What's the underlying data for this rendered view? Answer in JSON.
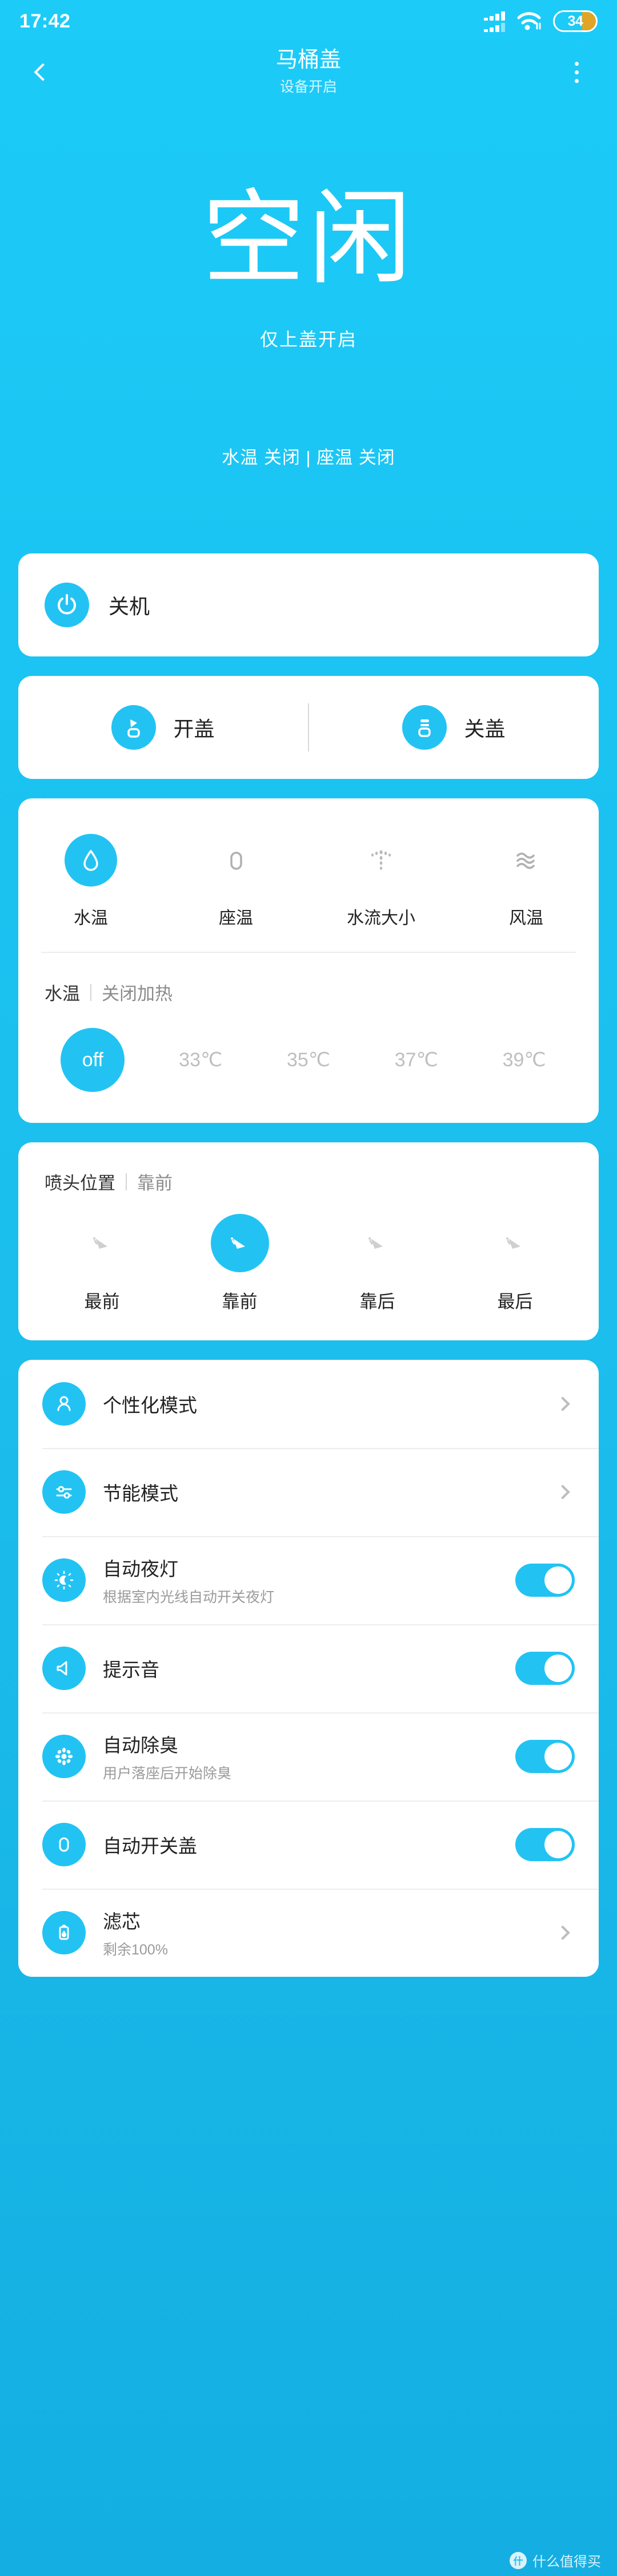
{
  "statusbar": {
    "time": "17:42",
    "battery_level": "34",
    "battery_fill_color": "#E0A526",
    "signal_icon": "signal-bars-icon",
    "wifi_icon": "wifi-icon"
  },
  "header": {
    "back_icon": "back-chevron-icon",
    "title": "马桶盖",
    "subtitle": "设备开启",
    "menu_icon": "more-vertical-icon"
  },
  "hero": {
    "state": "空闲",
    "sub": "仅上盖开启",
    "temps": "水温 关闭 | 座温 关闭"
  },
  "theme": {
    "accent": "#22C3F3",
    "background": "#1BC4F2",
    "card": "#FFFFFF"
  },
  "power_card": {
    "icon": "power-icon",
    "label": "关机"
  },
  "lid_card": {
    "open": {
      "icon": "lid-open-icon",
      "label": "开盖"
    },
    "close": {
      "icon": "lid-close-icon",
      "label": "关盖"
    }
  },
  "function_card": {
    "items": [
      {
        "icon": "water-drop-icon",
        "label": "水温",
        "active": true
      },
      {
        "icon": "toilet-seat-icon",
        "label": "座温",
        "active": false
      },
      {
        "icon": "water-spray-icon",
        "label": "水流大小",
        "active": false
      },
      {
        "icon": "wind-wave-icon",
        "label": "风温",
        "active": false
      }
    ],
    "setting_key": "水温",
    "setting_value": "关闭加热",
    "options": [
      {
        "label": "off",
        "selected": true
      },
      {
        "label": "33℃",
        "selected": false
      },
      {
        "label": "35℃",
        "selected": false
      },
      {
        "label": "37℃",
        "selected": false
      },
      {
        "label": "39℃",
        "selected": false
      }
    ]
  },
  "nozzle_card": {
    "setting_key": "喷头位置",
    "setting_value": "靠前",
    "options": [
      {
        "icon": "nozzle-position-icon",
        "label": "最前",
        "selected": false
      },
      {
        "icon": "nozzle-position-icon",
        "label": "靠前",
        "selected": true
      },
      {
        "icon": "nozzle-position-icon",
        "label": "靠后",
        "selected": false
      },
      {
        "icon": "nozzle-position-icon",
        "label": "最后",
        "selected": false
      }
    ]
  },
  "settings": {
    "rows": [
      {
        "icon": "person-icon",
        "title": "个性化模式",
        "desc": "",
        "control": "chevron"
      },
      {
        "icon": "sliders-icon",
        "title": "节能模式",
        "desc": "",
        "control": "chevron"
      },
      {
        "icon": "night-light-icon",
        "title": "自动夜灯",
        "desc": "根据室内光线自动开关夜灯",
        "control": "toggle",
        "on": true
      },
      {
        "icon": "speaker-icon",
        "title": "提示音",
        "desc": "",
        "control": "toggle",
        "on": true
      },
      {
        "icon": "deodorize-icon",
        "title": "自动除臭",
        "desc": "用户落座后开始除臭",
        "control": "toggle",
        "on": true
      },
      {
        "icon": "auto-lid-icon",
        "title": "自动开关盖",
        "desc": "",
        "control": "toggle",
        "on": true
      },
      {
        "icon": "filter-icon",
        "title": "滤芯",
        "desc": "剩余100%",
        "control": "chevron"
      }
    ]
  },
  "footer": {
    "mark": "什",
    "text": "什么值得买"
  }
}
